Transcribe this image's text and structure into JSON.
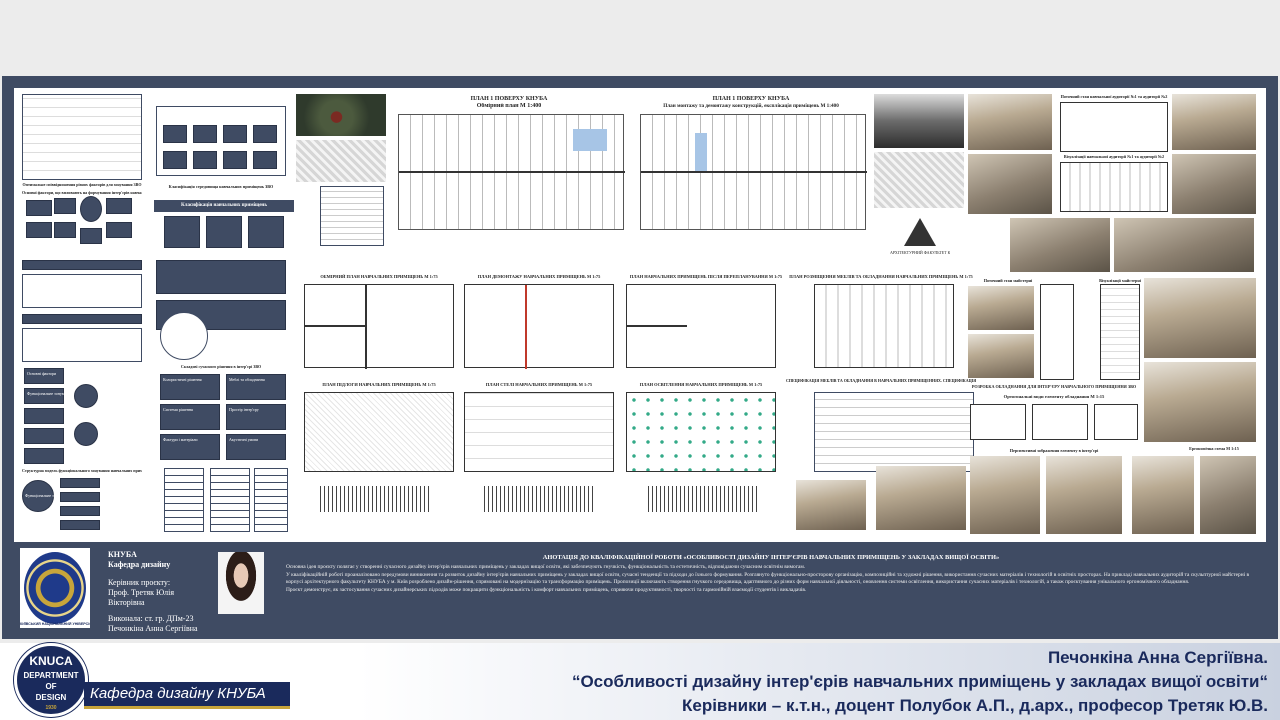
{
  "poster": {
    "top_center_titles": {
      "plan_measured": "ПЛАН 1 ПОВЕРХУ КНУБА",
      "plan_measured_sub": "Обмірний план М 1:400",
      "plan_demolition": "ПЛАН 1 ПОВЕРХУ КНУБА",
      "plan_demolition_sub": "План монтажу та демонтажу конструкцій, експлікація приміщень М 1:400"
    },
    "row_titles": [
      "ОБМІРНИЙ ПЛАН НАВЧАЛЬНИХ ПРИМІЩЕНЬ М 1:75",
      "ПЛАН ДЕМОНТАЖУ НАВЧАЛЬНИХ ПРИМІЩЕНЬ М 1:75",
      "ПЛАН НАВЧАЛЬНИХ ПРИМІЩЕНЬ ПІСЛЯ ПЕРЕПЛАНУВАННЯ М 1:75",
      "ПЛАН РОЗМІЩЕННЯ МЕБЛІВ ТА ОБЛАДНАННЯ НАВЧАЛЬНИХ ПРИМІЩЕНЬ М 1:75",
      "ПЛАН ПІДЛОГИ НАВЧАЛЬНИХ ПРИМІЩЕНЬ М 1:75",
      "ПЛАН СТЕЛІ НАВЧАЛЬНИХ ПРИМІЩЕНЬ М 1:75",
      "ПЛАН ОСВІТЛЕННЯ НАВЧАЛЬНИХ ПРИМІЩЕНЬ М 1:75"
    ],
    "right_titles": {
      "current_state": "Поточний стан навчальної аудиторії №1 та аудиторії №2",
      "visual_1": "Візуалізації навчальної аудиторії №1 та аудиторії №2",
      "workshop_state": "Поточний стан майстерні",
      "workshop_visual": "Візуалізації майстерні",
      "element_dev": "РОЗРОБКА ОБЛАДНАННЯ ДЛЯ ІНТЕР'ЄРУ НАВЧАЛЬНОГО ПРИМІЩЕННЯ ЗВО",
      "ortho": "Ортогональні види елементу обладнання М 1:15",
      "perspective": "Перспективні зображення елементу в інтер'єрі",
      "ergonomic": "Ергономічна схема М 1:15",
      "spec": "СПЕЦИФІКАЦІЯ МЕБЛІВ ТА ОБЛАДНАННЯ В НАВЧАЛЬНИХ ПРИМІЩЕННЯХ. СПЕЦИФІКАЦІЯ ОСВІТЛЮВАЛЬНИХ ПРИЛАДІВ. ПАСПОРТ ОЗДОБЛЕННЯ ПРИМІЩЕНЬ",
      "logo_caption": "АРХІТЕКТУРНИЙ ФАКУЛЬТЕТ КНУБА"
    },
    "left_titles": {
      "stand1": "Оптимальне співвідношення різних факторів для зонування ЗВО",
      "stand2": "Класифікація середовища навчальних приміщень ЗВО",
      "stand3": "Класифікація навчальних приміщень",
      "stand4": "Основні фактори, що впливають на формування інтер'єрів навчальних приміщень",
      "stand5": "Складові сучасного рішення в інтер'єрі ЗВО",
      "stand6": "Структурна модель функціонального зонування навчальних приміщень ЗВО"
    },
    "left_boxes": [
      "Основні фактори",
      "Функціональне зонування",
      "Рішення для формування простору",
      "Освітлення",
      "Колористичні рішення",
      "Меблі та обладнання",
      "Системи рішення",
      "Простір інтер'єру",
      "Фактури і матеріали",
      "Акустичні умови"
    ],
    "caption_unit": "Експлікація приміщень"
  },
  "info": {
    "seal_caption": "КИЇВСЬКИЙ НАЦІОНАЛЬНИЙ УНІВЕРСИТЕТ БУДІВНИЦТВА І АРХІТЕКТУРИ",
    "uni": "КНУБА",
    "dept": "Кафедра дизайну",
    "supervisor_label": "Керівник проєкту:",
    "supervisor_name": "Проф. Третяк Юлія Вікторівна",
    "author_label": "Виконала: ст. гр. ДПм-23",
    "author_name": "Печонкіна Анна Сергіївна",
    "abstract_title": "АНОТАЦІЯ ДО КВАЛІФІКАЦІЙНОЇ РОБОТИ «ОСОБЛИВОСТІ ДИЗАЙНУ ІНТЕР'ЄРІВ НАВЧАЛЬНИХ ПРИМІЩЕНЬ У ЗАКЛАДАХ ВИЩОЇ ОСВІТИ»",
    "abstract_p1": "Основна ідея проєкту полягає у створенні сучасного дизайну інтер'єрів навчальних приміщень у закладах вищої освіти, які забезпечують гнучкість, функціональність та естетичність, відповідаючи сучасним освітнім вимогам.",
    "abstract_p2": "У кваліфікаційній роботі проаналізовано передумови виникнення та розвиток дизайну інтер'єрів навчальних приміщень у закладах вищої освіти, сучасні тенденції та підходи до їхнього формування. Розглянуто функціонально-просторову організацію, композиційні та художні рішення, використання сучасних матеріалів і технологій в освітніх просторах. На прикладі навчальних аудиторій та скульптурної майстерні в корпусі архітектурного факультету КНУБА у м. Київ розроблено дизайн-рішення, спрямовані на модернізацію та трансформацію приміщень. Пропозиції включають створення гнучкого середовища, адаптивного до різних форм навчальної діяльності, оновлення системи освітлення, використання сучасних матеріалів і технологій, а також проєктування унікального ергономічного обладнання.",
    "abstract_p3": "Проєкт демонструє, як застосування сучасних дизайнерських підходів може покращити функціональність і комфорт навчальних приміщень, сприяючи продуктивності, творчості та гармонійній взаємодії студентів і викладачів."
  },
  "footer": {
    "badge_top": "KNUCA",
    "badge_mid1": "DEPARTMENT",
    "badge_mid2": "OF",
    "badge_bot": "DESIGN",
    "badge_year": "1930",
    "dept_label": "Кафедра дизайну КНУБА",
    "line1": "Печонкіна Анна Сергіївна.",
    "line2": "“Особливості дизайну інтер'єрів навчальних приміщень у закладах вищої освіти“",
    "line3": "Керівники – к.т.н., доцент Полубок А.П., д.арх., професор Третяк Ю.В."
  },
  "colors": {
    "poster_frame": "#3f4b63",
    "footer_blue": "#1a2a5c",
    "accent_gold": "#c8a53b"
  }
}
